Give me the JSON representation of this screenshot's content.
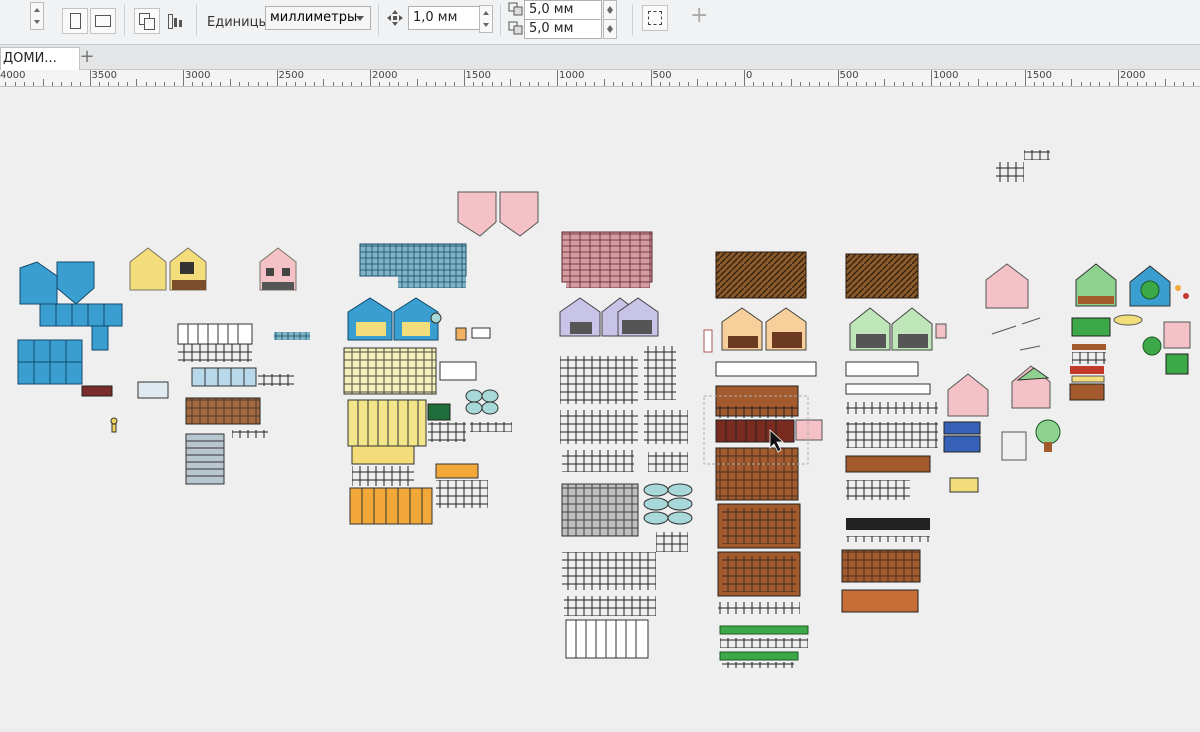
{
  "toolbar": {
    "units_label": "Единицы:",
    "units_value": "миллиметры",
    "nudge_value": "1,0 мм",
    "dup_x_value": "5,0 мм",
    "dup_y_value": "5,0 мм"
  },
  "tabs": [
    {
      "label": "ДОМИ..."
    }
  ],
  "ruler": {
    "labels": [
      "4000",
      "3500",
      "3000",
      "2500",
      "2000",
      "1500",
      "1000",
      "500",
      "0",
      "500",
      "1000",
      "1500",
      "2000"
    ]
  },
  "colors": {
    "blue": "#3a9fd0",
    "yellow": "#f3dd7a",
    "pink": "#f4c2c6",
    "brown": "#a35a2c",
    "green": "#3ca848",
    "mint": "#a8d8d8"
  }
}
